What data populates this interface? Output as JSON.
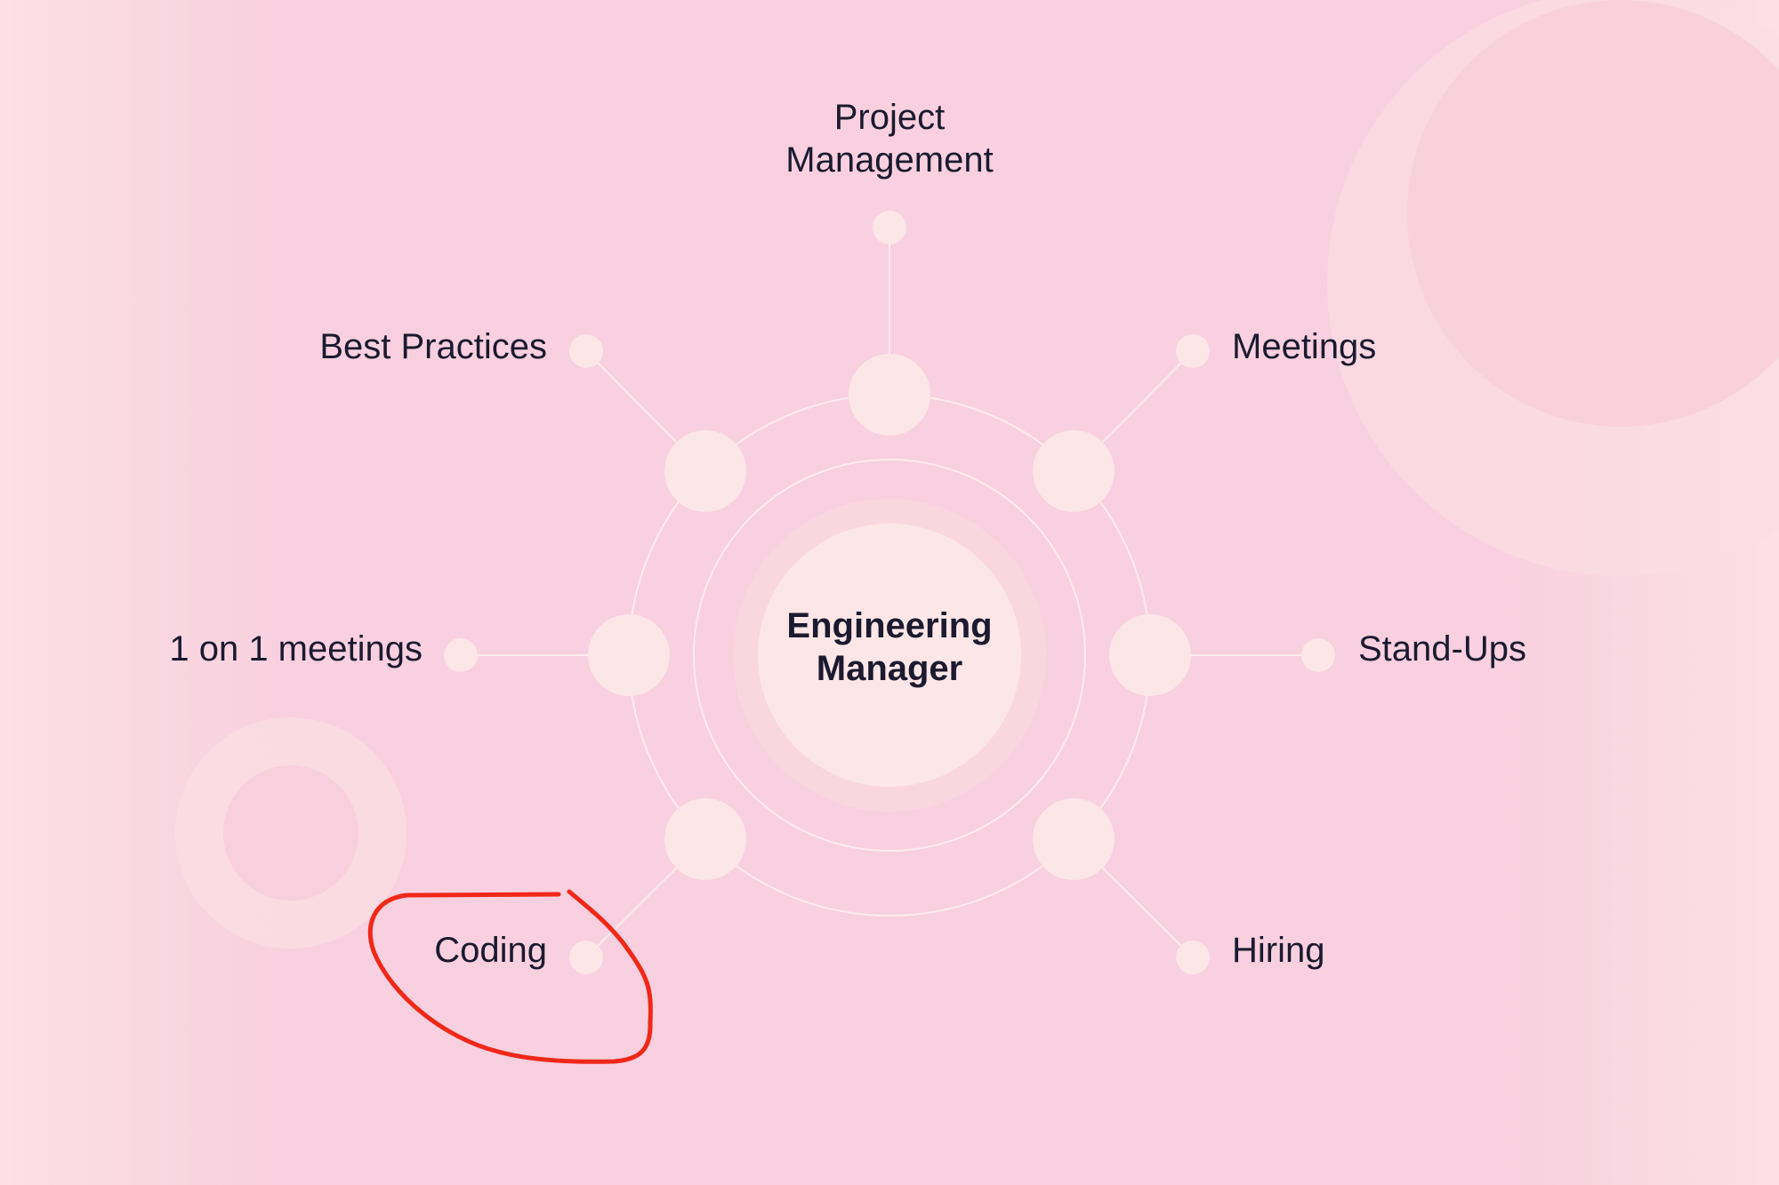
{
  "diagram": {
    "center": {
      "line1": "Engineering",
      "line2": "Manager"
    },
    "topics": [
      {
        "id": "project-management",
        "line1": "Project",
        "line2": "Management"
      },
      {
        "id": "meetings",
        "label": "Meetings"
      },
      {
        "id": "stand-ups",
        "label": "Stand-Ups"
      },
      {
        "id": "hiring",
        "label": "Hiring"
      },
      {
        "id": "coding",
        "label": "Coding",
        "highlighted": true
      },
      {
        "id": "one-on-one",
        "label": "1 on 1 meetings"
      },
      {
        "id": "best-practices",
        "label": "Best Practices"
      }
    ]
  },
  "colors": {
    "background": "#f9d0df",
    "node_fill": "#fde6e7",
    "line": "#fdecee",
    "text": "#1c1a2e",
    "highlight": "#f0281a"
  }
}
